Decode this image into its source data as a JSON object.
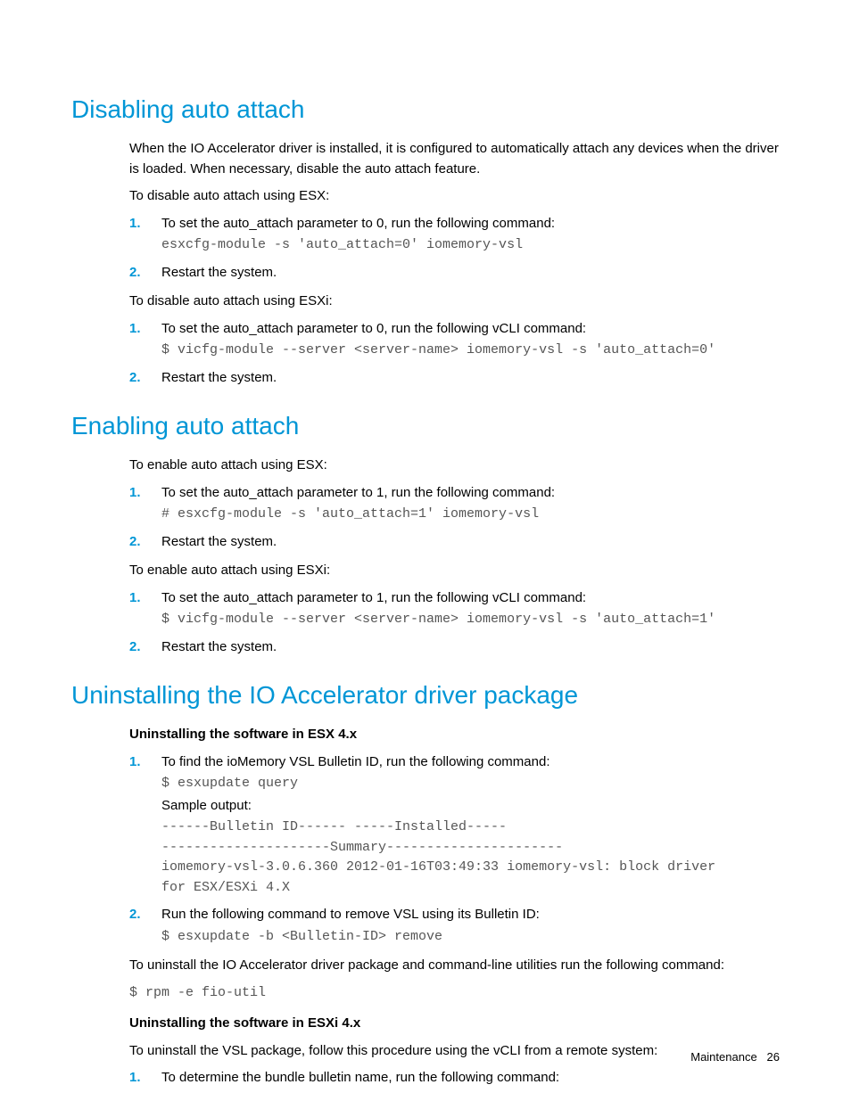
{
  "sections": {
    "disabling": {
      "heading": "Disabling auto attach",
      "intro": "When the IO Accelerator driver is installed, it is configured to automatically attach any devices when the driver is loaded. When necessary, disable the auto attach feature.",
      "esx_intro": "To disable auto attach using ESX:",
      "esx_steps": [
        {
          "text": "To set the auto_attach parameter to 0, run the following command:",
          "code": "esxcfg-module -s 'auto_attach=0' iomemory-vsl"
        },
        {
          "text": "Restart the system."
        }
      ],
      "esxi_intro": "To disable auto attach using ESXi:",
      "esxi_steps": [
        {
          "text": "To set the auto_attach parameter to 0, run the following vCLI command:",
          "code": "$ vicfg-module --server <server-name> iomemory-vsl -s 'auto_attach=0'"
        },
        {
          "text": "Restart the system."
        }
      ]
    },
    "enabling": {
      "heading": "Enabling auto attach",
      "esx_intro": "To enable auto attach using ESX:",
      "esx_steps": [
        {
          "text": "To set the auto_attach parameter to 1, run the following command:",
          "code": "# esxcfg-module -s 'auto_attach=1' iomemory-vsl"
        },
        {
          "text": "Restart the system."
        }
      ],
      "esxi_intro": "To enable auto attach using ESXi:",
      "esxi_steps": [
        {
          "text": "To set the auto_attach parameter to 1, run the following vCLI command:",
          "code": "$ vicfg-module --server <server-name> iomemory-vsl -s 'auto_attach=1'"
        },
        {
          "text": "Restart the system."
        }
      ]
    },
    "uninstalling": {
      "heading": "Uninstalling the IO Accelerator driver package",
      "sub1": "Uninstalling the software in ESX 4.x",
      "steps1": [
        {
          "text": "To find the ioMemory VSL Bulletin ID, run the following command:",
          "code": "$ esxupdate query",
          "sample_label": "Sample output:",
          "output1": "------Bulletin ID------ -----Installed-----",
          "output2": "---------------------Summary----------------------",
          "output3": "iomemory-vsl-3.0.6.360 2012-01-16T03:49:33 iomemory-vsl: block driver",
          "output4": "for ESX/ESXi 4.X"
        },
        {
          "text": "Run the following command to remove VSL using its Bulletin ID:",
          "code": "$ esxupdate -b <Bulletin-ID> remove"
        }
      ],
      "post1_text": "To uninstall the IO Accelerator driver package and command-line utilities run the following command:",
      "post1_code": "$ rpm -e fio-util",
      "sub2": "Uninstalling the software in ESXi 4.x",
      "sub2_intro": "To uninstall the VSL package, follow this procedure using the vCLI from a remote system:",
      "steps2": [
        {
          "text": "To determine the bundle bulletin name, run the following command:"
        }
      ]
    }
  },
  "nums": {
    "1": "1.",
    "2": "2."
  },
  "footer": {
    "label": "Maintenance",
    "page": "26"
  }
}
